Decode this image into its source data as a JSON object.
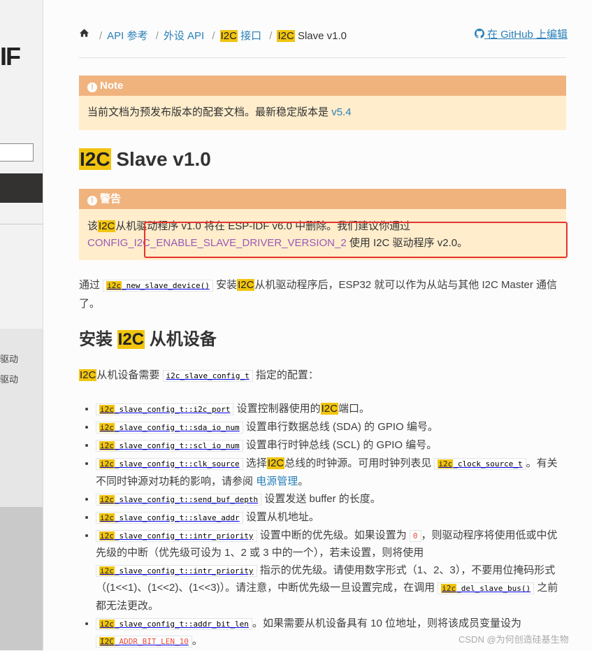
{
  "sidebar": {
    "logo_fragment": "IF",
    "item1": "驱动",
    "item2": "驱动"
  },
  "breadcrumb": {
    "home_icon": "home-icon",
    "items": [
      "API 参考",
      "外设 API",
      "接口",
      "Slave v1.0"
    ],
    "hl": "I2C",
    "github_icon": "github-icon",
    "edit_label": "在 GitHub 上编辑"
  },
  "note": {
    "title": "Note",
    "text": "当前文档为预发布版本的配套文档。最新稳定版本是",
    "link": "v5.4"
  },
  "title": {
    "hl": "I2C",
    "rest": "Slave v1.0"
  },
  "warning": {
    "title": "警告",
    "t1": "该",
    "hl": "I2C",
    "t2": "从机驱动程序 v1.0 将在 ESP-IDF v6.0 中删除。我们建议你通过",
    "config_link": "CONFIG_I2C_ENABLE_SLAVE_DRIVER_VERSION_2",
    "t3": "使用 I2C 驱动程序 v2.0。"
  },
  "intro": {
    "t1": "通过",
    "code_hl": "i2c",
    "code_rest": "_new_slave_device()",
    "t2": "安装",
    "hl": "I2C",
    "t3": "从机驱动程序后，ESP32 就可以作为从站与其他 I2C Master 通信了。"
  },
  "section": {
    "hl": "I2C",
    "pre": "安装",
    "post": "从机设备"
  },
  "config_intro": {
    "hl": "I2C",
    "t1": "从机设备需要",
    "code": "i2c_slave_config_t",
    "t2": "指定的配置："
  },
  "fields": [
    {
      "code_rest": "_slave_config_t::i2c_port",
      "t1": "设置控制器使用的",
      "hl2": "I2C",
      "t2": "端口。"
    },
    {
      "code_rest": "_slave_config_t::sda_io_num",
      "t1": "设置串行数据总线 (SDA) 的 GPIO 编号。"
    },
    {
      "code_rest": "_slave_config_t::scl_io_num",
      "t1": "设置串行时钟总线 (SCL) 的 GPIO 编号。"
    },
    {
      "code_rest": "_slave_config_t::clk_source",
      "t1": "选择",
      "hl2": "I2C",
      "t2": "总线的时钟源。可用时钟列表见",
      "code2_rest": "_clock_source_t",
      "t3": "。有关不同时钟源对功耗的影响，请参阅",
      "link": "电源管理",
      "t4": "。"
    },
    {
      "code_rest": "_slave_config_t::send_buf_depth",
      "t1": "设置发送 buffer 的长度。"
    },
    {
      "code_rest": "_slave_config_t::slave_addr",
      "t1": "设置从机地址。"
    },
    {
      "code_rest": "_slave_config_t::intr_priority",
      "t1": "设置中断的优先级。如果设置为",
      "code_zero": "0",
      "t2": "，则驱动程序将使用低或中优先级的中断（优先级可设为 1、2 或 3 中的一个），若未设置，则将使用",
      "code2_rest": "_slave_config_t::intr_priority",
      "t3": "指示的优先级。请使用数字形式（1、2、3），不要用位掩码形式（(1<<1)、(1<<2)、(1<<3)）。请注意，中断优先级一旦设置完成，在调用",
      "code3_rest": "_del_slave_bus()",
      "t4": "之前都无法更改。"
    },
    {
      "code_rest": "_slave_config_t::addr_bit_len",
      "t1": "。如果需要从机设备具有 10 位地址，则将该成员变量设为",
      "code2_hl": "I2C",
      "code2_rest": "_ADDR_BIT_LEN_10",
      "t2": "。"
    }
  ],
  "code_hl": "i2c",
  "watermark": "CSDN @为何创造硅基生物"
}
